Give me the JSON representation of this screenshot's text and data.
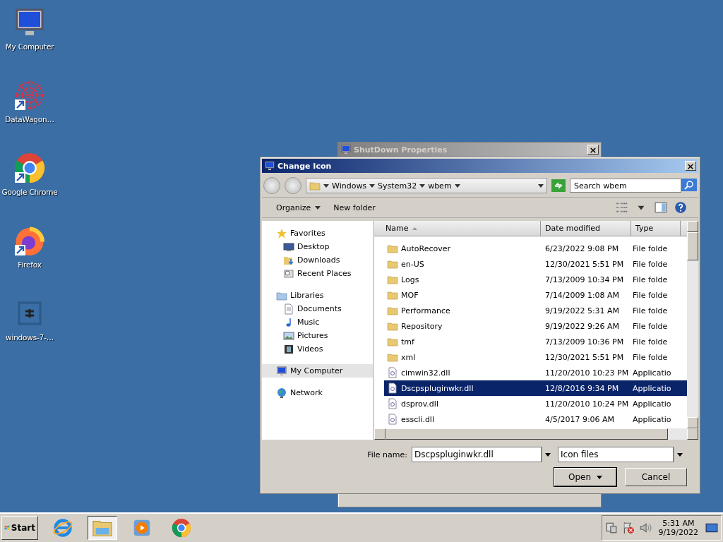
{
  "desktop_icons": [
    {
      "label": "My Computer",
      "kind": "computer"
    },
    {
      "label": "DataWagon…",
      "kind": "datawagon",
      "shortcut": true
    },
    {
      "label": "Google Chrome",
      "kind": "chrome",
      "shortcut": true
    },
    {
      "label": "Firefox",
      "kind": "firefox",
      "shortcut": true
    },
    {
      "label": "windows-7-…",
      "kind": "file"
    }
  ],
  "back_window": {
    "title": "ShutDown Properties",
    "close": "×"
  },
  "dialog": {
    "title": "Change Icon",
    "close": "×",
    "breadcrumb": [
      "Windows",
      "System32",
      "wbem"
    ],
    "search": {
      "placeholder": "Search wbem"
    },
    "toolbar": [
      "Organize",
      "New folder"
    ],
    "nav": [
      {
        "label": "Favorites",
        "kind": "star",
        "children": [
          {
            "label": "Desktop",
            "kind": "desktop"
          },
          {
            "label": "Downloads",
            "kind": "downloads"
          },
          {
            "label": "Recent Places",
            "kind": "recent"
          }
        ]
      },
      {
        "label": "Libraries",
        "kind": "libraries",
        "children": [
          {
            "label": "Documents",
            "kind": "documents"
          },
          {
            "label": "Music",
            "kind": "music"
          },
          {
            "label": "Pictures",
            "kind": "pictures"
          },
          {
            "label": "Videos",
            "kind": "videos"
          }
        ]
      },
      {
        "label": "My Computer",
        "kind": "computer",
        "selected": true
      },
      {
        "label": "Network",
        "kind": "network",
        "selected": false
      }
    ],
    "columns": [
      "Name",
      "Date modified",
      "Type"
    ],
    "rows": [
      {
        "name": "AutoRecover",
        "date": "6/23/2022 9:08 PM",
        "type": "File folde",
        "kind": "folder",
        "selected": false
      },
      {
        "name": "en-US",
        "date": "12/30/2021 5:51 PM",
        "type": "File folde",
        "kind": "folder",
        "selected": false
      },
      {
        "name": "Logs",
        "date": "7/13/2009 10:34 PM",
        "type": "File folde",
        "kind": "folder",
        "selected": false
      },
      {
        "name": "MOF",
        "date": "7/14/2009 1:08 AM",
        "type": "File folde",
        "kind": "folder",
        "selected": false
      },
      {
        "name": "Performance",
        "date": "9/19/2022 5:31 AM",
        "type": "File folde",
        "kind": "folder",
        "selected": false
      },
      {
        "name": "Repository",
        "date": "9/19/2022 9:26 AM",
        "type": "File folde",
        "kind": "folder",
        "selected": false
      },
      {
        "name": "tmf",
        "date": "7/13/2009 10:36 PM",
        "type": "File folde",
        "kind": "folder",
        "selected": false
      },
      {
        "name": "xml",
        "date": "12/30/2021 5:51 PM",
        "type": "File folde",
        "kind": "folder",
        "selected": false
      },
      {
        "name": "cimwin32.dll",
        "date": "11/20/2010 10:23 PM",
        "type": "Applicatio",
        "kind": "dll",
        "selected": false
      },
      {
        "name": "Dscpspluginwkr.dll",
        "date": "12/8/2016 9:34 PM",
        "type": "Applicatio",
        "kind": "dll",
        "selected": true
      },
      {
        "name": "dsprov.dll",
        "date": "11/20/2010 10:24 PM",
        "type": "Applicatio",
        "kind": "dll",
        "selected": false
      },
      {
        "name": "esscli.dll",
        "date": "4/5/2017 9:06 AM",
        "type": "Applicatio",
        "kind": "dll",
        "selected": false
      }
    ],
    "file_name_label": "File name:",
    "file_name": "Dscpspluginwkr.dll",
    "file_type": "Icon files",
    "buttons": [
      "Open",
      "Cancel"
    ]
  },
  "taskbar": {
    "start": "Start",
    "apps": [
      {
        "kind": "ie",
        "selected": false
      },
      {
        "kind": "explorer",
        "selected": true
      },
      {
        "kind": "media",
        "selected": false
      },
      {
        "kind": "chrome",
        "selected": false
      }
    ],
    "time": "5:31 AM",
    "date": "9/19/2022"
  }
}
